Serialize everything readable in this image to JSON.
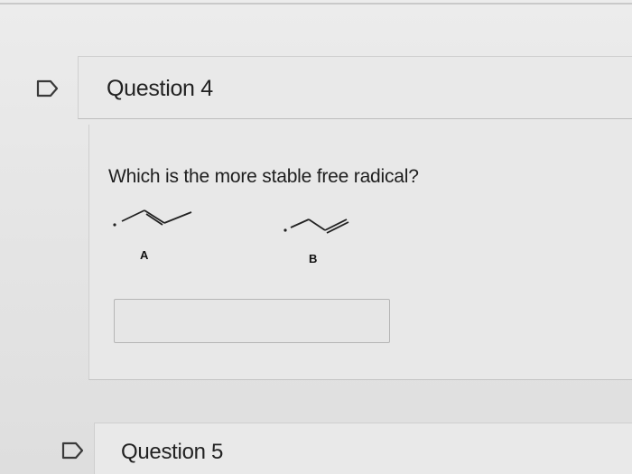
{
  "question4": {
    "title": "Question 4",
    "prompt": "Which is the more stable free radical?",
    "choices": [
      {
        "label": "A",
        "molecule": "allyl-radical-skeletal"
      },
      {
        "label": "B",
        "molecule": "propenyl-radical-skeletal"
      }
    ],
    "answer_value": ""
  },
  "question5": {
    "title": "Question 5"
  },
  "icons": {
    "flag": "flag-outline-icon"
  },
  "colors": {
    "page_bg": "#e6e6e6",
    "panel_bg": "#e9e9e9",
    "text": "#1f1f1f"
  }
}
